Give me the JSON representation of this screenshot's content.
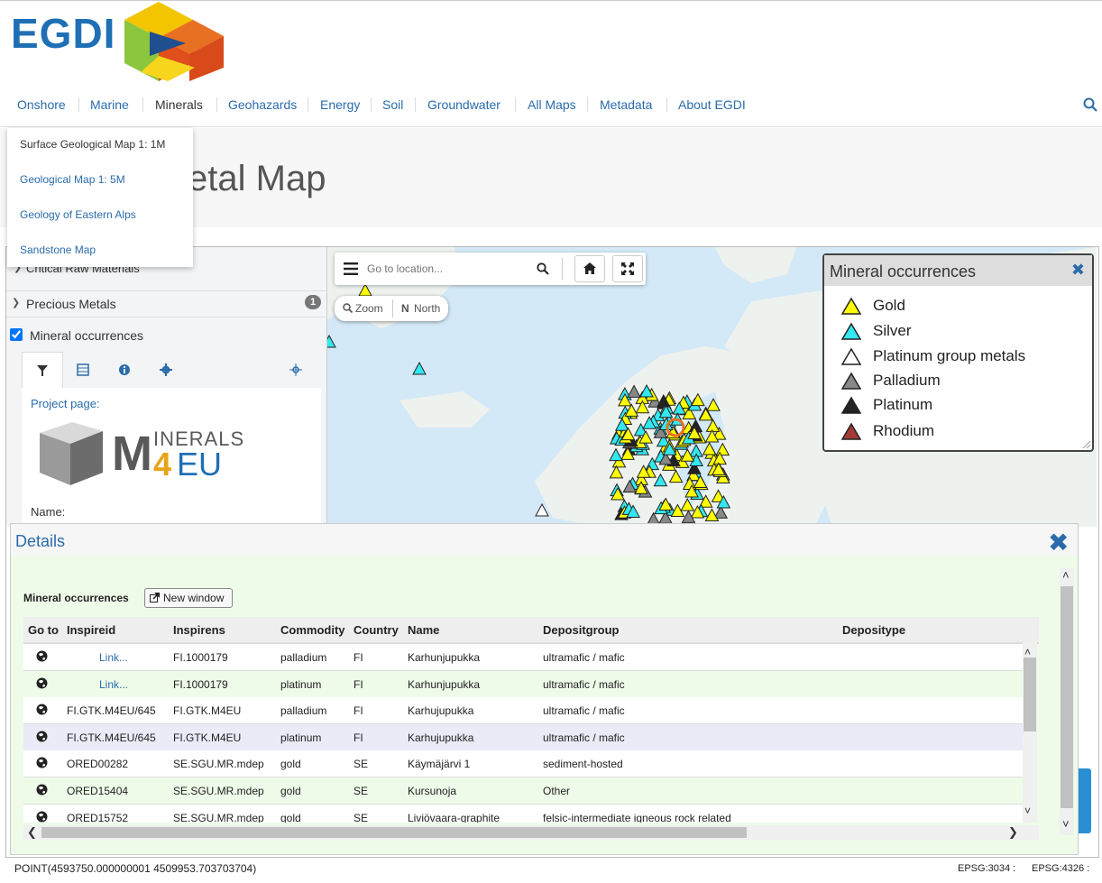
{
  "header": {
    "logo_text": "EGDI",
    "nav": [
      {
        "label": "Onshore",
        "bold": false
      },
      {
        "label": "Marine",
        "bold": false
      },
      {
        "label": "Minerals",
        "bold": true
      },
      {
        "label": "Geohazards",
        "bold": false
      },
      {
        "label": "Energy",
        "bold": false
      },
      {
        "label": "Soil",
        "bold": false
      },
      {
        "label": "Groundwater",
        "bold": false
      },
      {
        "label": "All Maps",
        "bold": false
      },
      {
        "label": "Metadata",
        "bold": false
      },
      {
        "label": "About EGDI",
        "bold": false
      }
    ]
  },
  "dropdown": {
    "items": [
      "Surface Geological Map 1: 1M",
      "Geological Map 1: 5M",
      "Geology of Eastern Alps",
      "Sandstone Map"
    ],
    "active_index": 0
  },
  "page": {
    "title": "Precious Metal Map"
  },
  "sidebar": {
    "group_critical": "Critical Raw Materials",
    "group_precious": "Precious Metals",
    "precious_count": "1",
    "layer_label": "Mineral occurrences",
    "layer_checked": true,
    "project_page_label": "Project page:",
    "project_logo_text_m": "M",
    "project_logo_text_inerals": "INERALS",
    "project_logo_text_4": "4",
    "project_logo_text_eu": "EU",
    "name_label": "Name:"
  },
  "map_controls": {
    "goto_placeholder": "Go to location...",
    "zoom_label": "Zoom",
    "north_label": "North"
  },
  "legend": {
    "title": "Mineral occurrences",
    "items": [
      {
        "label": "Gold",
        "color": "#ffff00"
      },
      {
        "label": "Silver",
        "color": "#33e8f0"
      },
      {
        "label": "Platinum group metals",
        "color": "#ffffff"
      },
      {
        "label": "Palladium",
        "color": "#888888"
      },
      {
        "label": "Platinum",
        "color": "#222222"
      },
      {
        "label": "Rhodium",
        "color": "#a33a35"
      }
    ]
  },
  "details": {
    "title": "Details",
    "table_label": "Mineral occurrences",
    "new_window_label": "New window",
    "columns": [
      "Go to",
      "Inspireid",
      "Inspirens",
      "Commodity",
      "Country",
      "Name",
      "Depositgroup",
      "Depositype"
    ],
    "rows": [
      {
        "inspireid": "Link...",
        "is_link": true,
        "inspirens": "FI.1000179",
        "commodity": "palladium",
        "country": "FI",
        "name": "Karhunjupukka",
        "depositgroup": "ultramafic / mafic",
        "deposittype": ""
      },
      {
        "inspireid": "Link...",
        "is_link": true,
        "inspirens": "FI.1000179",
        "commodity": "platinum",
        "country": "FI",
        "name": "Karhunjupukka",
        "depositgroup": "ultramafic / mafic",
        "deposittype": ""
      },
      {
        "inspireid": "FI.GTK.M4EU/645",
        "is_link": false,
        "inspirens": "FI.GTK.M4EU",
        "commodity": "palladium",
        "country": "FI",
        "name": "Karhujupukka",
        "depositgroup": "ultramafic / mafic",
        "deposittype": ""
      },
      {
        "inspireid": "FI.GTK.M4EU/645",
        "is_link": false,
        "inspirens": "FI.GTK.M4EU",
        "commodity": "platinum",
        "country": "FI",
        "name": "Karhujupukka",
        "depositgroup": "ultramafic / mafic",
        "deposittype": ""
      },
      {
        "inspireid": "ORED00282",
        "is_link": false,
        "inspirens": "SE.SGU.MR.mdep",
        "commodity": "gold",
        "country": "SE",
        "name": "Käymäjärvi 1",
        "depositgroup": "sediment-hosted",
        "deposittype": ""
      },
      {
        "inspireid": "ORED15404",
        "is_link": false,
        "inspirens": "SE.SGU.MR.mdep",
        "commodity": "gold",
        "country": "SE",
        "name": "Kursunoja",
        "depositgroup": "Other",
        "deposittype": ""
      },
      {
        "inspireid": "ORED15752",
        "is_link": false,
        "inspirens": "SE.SGU.MR.mdep",
        "commodity": "gold",
        "country": "SE",
        "name": "Liviövaara-graphite",
        "depositgroup": "felsic-intermediate igneous rock related",
        "deposittype": ""
      }
    ],
    "row_colors": [
      "#ffffff",
      "#eefbe9",
      "#ffffff",
      "#ebebf8",
      "#ffffff",
      "#eefbe9",
      "#ffffff"
    ]
  },
  "status": {
    "coords": "POINT(4593750.000000001 4509953.703703704)",
    "epsg3034": "EPSG:3034 :",
    "epsg4326": "EPSG:4326 :"
  }
}
